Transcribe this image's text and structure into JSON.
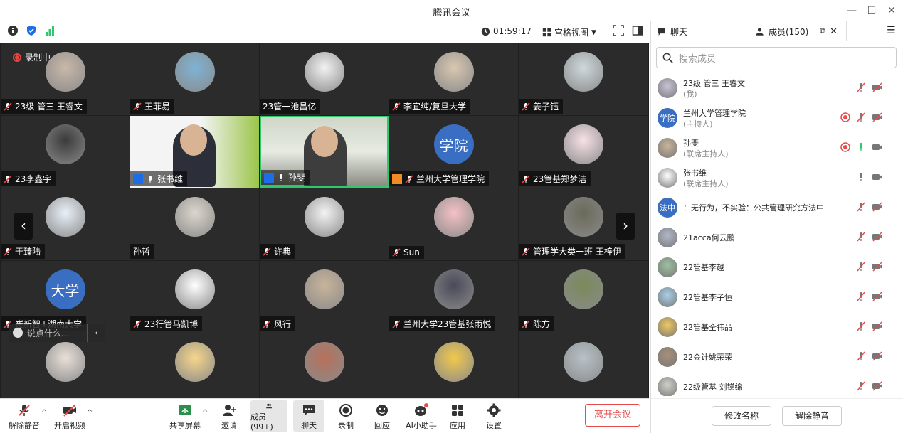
{
  "app": {
    "title": "腾讯会议"
  },
  "toolbar": {
    "timer": "01:59:17",
    "view_label": "宫格视图"
  },
  "grid": {
    "recording_label": "录制中",
    "chat_placeholder": "说点什么...",
    "tiles": [
      {
        "name": "23级 管三 王睿文",
        "mic": "off",
        "avatar": "photo"
      },
      {
        "name": "王菲易",
        "mic": "off",
        "avatar": "photo"
      },
      {
        "name": "23管一池昌亿",
        "mic": "none",
        "avatar": "photo"
      },
      {
        "name": "李宜纯/复旦大学",
        "mic": "off",
        "avatar": "photo"
      },
      {
        "name": "姜子钰",
        "mic": "off",
        "avatar": "photo"
      },
      {
        "name": "23李鑫宇",
        "mic": "off",
        "avatar": "photo"
      },
      {
        "name": "张书维",
        "mic": "on",
        "avatar": "video"
      },
      {
        "name": "孙斐",
        "mic": "on",
        "avatar": "video"
      },
      {
        "name": "兰州大学管理学院",
        "mic": "off",
        "avatar": "text",
        "avatar_text": "学院"
      },
      {
        "name": "23管基郑梦洁",
        "mic": "off",
        "avatar": "photo"
      },
      {
        "name": "于臻陆",
        "mic": "off",
        "avatar": "photo"
      },
      {
        "name": "孙哲",
        "mic": "none",
        "avatar": "photo"
      },
      {
        "name": "许典",
        "mic": "off",
        "avatar": "photo"
      },
      {
        "name": "Sun",
        "mic": "off",
        "avatar": "photo"
      },
      {
        "name": "管理学大类一班 王梓伊",
        "mic": "off",
        "avatar": "photo"
      },
      {
        "name": "崔新智+湖南大学",
        "mic": "off",
        "avatar": "text",
        "avatar_text": "大学"
      },
      {
        "name": "23行管马凯博",
        "mic": "off",
        "avatar": "photo"
      },
      {
        "name": "风行",
        "mic": "off",
        "avatar": "photo"
      },
      {
        "name": "兰州大学23管基张雨悦",
        "mic": "off",
        "avatar": "photo"
      },
      {
        "name": "陈方",
        "mic": "off",
        "avatar": "photo"
      },
      {
        "name": "",
        "mic": "off",
        "avatar": "photo"
      },
      {
        "name": "",
        "mic": "off",
        "avatar": "photo"
      },
      {
        "name": "",
        "mic": "off",
        "avatar": "photo"
      },
      {
        "name": "",
        "mic": "off",
        "avatar": "photo"
      },
      {
        "name": "",
        "mic": "off",
        "avatar": "photo"
      }
    ]
  },
  "bottombar": {
    "unmute": "解除静音",
    "start_video": "开启视频",
    "share": "共享屏幕",
    "invite": "邀请",
    "members": "成员(99+)",
    "chat": "聊天",
    "record": "录制",
    "reaction": "回应",
    "ai": "AI小助手",
    "apps": "应用",
    "settings": "设置",
    "leave": "离开会议"
  },
  "panel": {
    "tab_chat": "聊天",
    "tab_members": "成员(150)",
    "search_placeholder": "搜索成员",
    "members": [
      {
        "name": "23级 管三 王睿文",
        "role": "(我)",
        "avatar": "photo",
        "rec": false,
        "mic": "off",
        "cam": "off"
      },
      {
        "name": "兰州大学管理学院",
        "role": "(主持人)",
        "avatar": "text",
        "avatar_text": "学院",
        "rec": true,
        "mic": "off",
        "cam": "off"
      },
      {
        "name": "孙斐",
        "role": "(联席主持人)",
        "avatar": "photo",
        "rec": true,
        "mic": "on",
        "cam": "on"
      },
      {
        "name": "张书维",
        "role": "(联席主持人)",
        "avatar": "photo",
        "rec": false,
        "mic": "on-gray",
        "cam": "on-gray"
      },
      {
        "name": "：无行为，不实验：公共管理研究方法中",
        "role": "",
        "avatar": "text",
        "avatar_text": "法中",
        "rec": false,
        "mic": "off",
        "cam": "off"
      },
      {
        "name": "21acca何云鹏",
        "role": "",
        "avatar": "photo",
        "rec": false,
        "mic": "off",
        "cam": "off"
      },
      {
        "name": "22管基李越",
        "role": "",
        "avatar": "photo",
        "rec": false,
        "mic": "off",
        "cam": "off"
      },
      {
        "name": "22管基李子恒",
        "role": "",
        "avatar": "photo",
        "rec": false,
        "mic": "off",
        "cam": "off"
      },
      {
        "name": "22管基仝祎品",
        "role": "",
        "avatar": "photo",
        "rec": false,
        "mic": "off",
        "cam": "off"
      },
      {
        "name": "22会计姚荣荣",
        "role": "",
        "avatar": "photo",
        "rec": false,
        "mic": "off",
        "cam": "off"
      },
      {
        "name": "22级管基 刘锑绵",
        "role": "",
        "avatar": "photo",
        "rec": false,
        "mic": "off",
        "cam": "off"
      }
    ],
    "rename": "修改名称",
    "unmute": "解除静音"
  }
}
